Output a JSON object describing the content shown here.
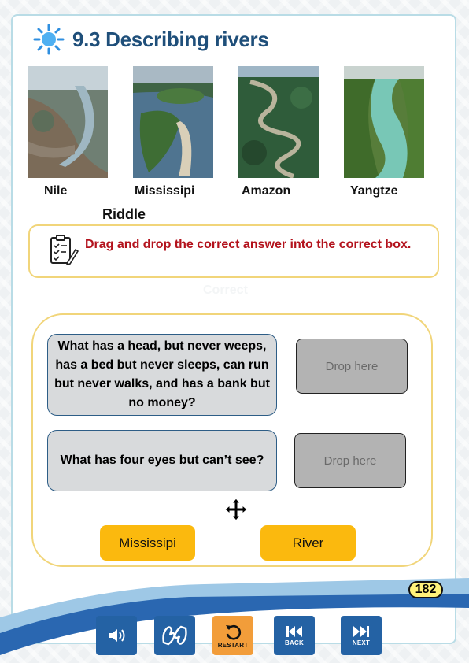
{
  "header": {
    "title": "9.3 Describing rivers",
    "icon": "sun-icon"
  },
  "rivers": [
    {
      "name": "Nile"
    },
    {
      "name": "Mississipi"
    },
    {
      "name": "Amazon"
    },
    {
      "name": "Yangtze"
    }
  ],
  "riddle_label": "Riddle",
  "instruction": {
    "text": "Drag and drop the correct answer into the correct box.",
    "icon": "clipboard-check-icon"
  },
  "ghost_text": "Correct",
  "questions": [
    {
      "text": "What has a head, but never weeps, has a bed but never sleeps, can run but never walks, and has a bank but no money?",
      "drop_label": "Drop here"
    },
    {
      "text": "What has four eyes but can’t see?",
      "drop_label": "Drop here"
    }
  ],
  "answers": [
    "Mississipi",
    "River"
  ],
  "page_number": "182",
  "toolbar": {
    "audio_icon": "speaker-icon",
    "sign_icon": "sign-language-icon",
    "restart_label": "RESTART",
    "back_label": "BACK",
    "next_label": "NEXT"
  },
  "colors": {
    "title": "#1f4f7a",
    "instruction": "#b3121c",
    "answer_button": "#fbb90e",
    "nav_button": "#2462a4",
    "restart_button": "#f29d3a"
  }
}
